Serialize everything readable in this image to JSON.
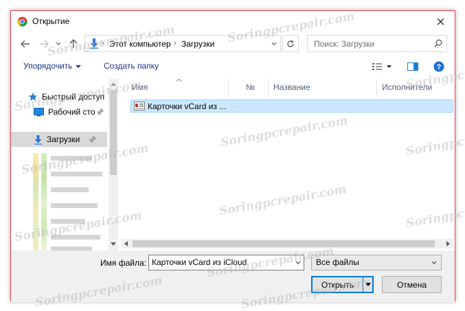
{
  "window": {
    "title": "Открытие"
  },
  "address_bar": {
    "segments": [
      "Этот компьютер",
      "Загрузки"
    ],
    "separator": "›"
  },
  "search": {
    "placeholder": "Поиск: Загрузки"
  },
  "toolbar": {
    "organize_label": "Упорядочить",
    "new_folder_label": "Создать папку"
  },
  "sidebar": {
    "items": [
      {
        "label": "Быстрый доступ",
        "icon": "star-icon"
      },
      {
        "label": "Рабочий сто",
        "icon": "desktop-icon",
        "pinned": true
      },
      {
        "label": "Загрузки",
        "icon": "download-arrow-icon",
        "pinned": true,
        "selected": true
      }
    ]
  },
  "file_list": {
    "columns": [
      "Имя",
      "№",
      "Название",
      "Исполнители"
    ],
    "files": [
      {
        "name": "Карточки vCard из ...",
        "icon": "vcard-file-icon",
        "selected": true
      }
    ]
  },
  "footer": {
    "file_name_label": "Имя файла:",
    "file_name_value": "Карточки vCard из iCloud",
    "file_type_value": "Все файлы",
    "open_label": "Открыть",
    "cancel_label": "Отмена"
  },
  "watermark": {
    "text": "Soringpcrepair.com"
  },
  "colors": {
    "accent": "#0078d7",
    "selection": "#cce8ff",
    "link_text": "#1e3287",
    "dialog_border": "#e5424f"
  }
}
